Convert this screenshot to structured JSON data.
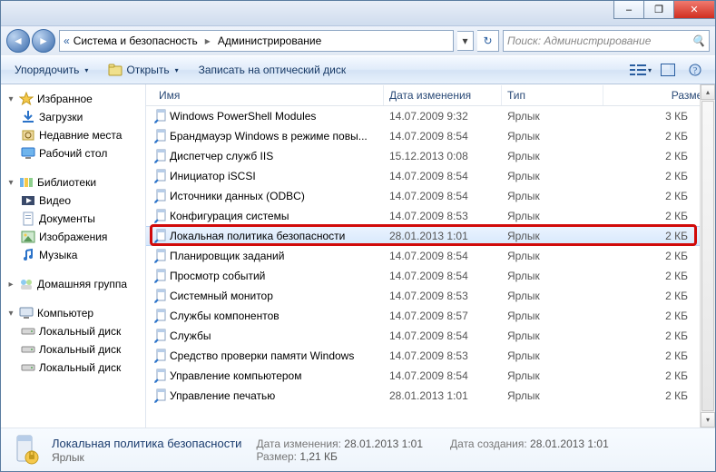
{
  "chrome": {
    "minimize": "–",
    "maximize": "❐",
    "close": "✕"
  },
  "address": {
    "back": "◄",
    "forward": "►",
    "crumbs": [
      "Система и безопасность",
      "Администрирование"
    ],
    "dropdown": "▾",
    "refresh": "↻"
  },
  "search": {
    "placeholder": "Поиск: Администрирование",
    "icon": "🔍"
  },
  "toolbar": {
    "organize": "Упорядочить",
    "open": "Открыть",
    "burn": "Записать на оптический диск",
    "dd": "▾"
  },
  "columns": {
    "name": "Имя",
    "date": "Дата изменения",
    "type": "Тип",
    "size": "Размер"
  },
  "nav": {
    "favorites": {
      "label": "Избранное",
      "items": [
        "Загрузки",
        "Недавние места",
        "Рабочий стол"
      ]
    },
    "libraries": {
      "label": "Библиотеки",
      "items": [
        "Видео",
        "Документы",
        "Изображения",
        "Музыка"
      ]
    },
    "homegroup": {
      "label": "Домашняя группа"
    },
    "computer": {
      "label": "Компьютер",
      "items": [
        "Локальный диск",
        "Локальный диск",
        "Локальный диск"
      ]
    }
  },
  "files": [
    {
      "name": "Windows PowerShell Modules",
      "date": "14.07.2009 9:32",
      "type": "Ярлык",
      "size": "3 КБ"
    },
    {
      "name": "Брандмауэр Windows в режиме повы...",
      "date": "14.07.2009 8:54",
      "type": "Ярлык",
      "size": "2 КБ"
    },
    {
      "name": "Диспетчер служб IIS",
      "date": "15.12.2013 0:08",
      "type": "Ярлык",
      "size": "2 КБ"
    },
    {
      "name": "Инициатор iSCSI",
      "date": "14.07.2009 8:54",
      "type": "Ярлык",
      "size": "2 КБ"
    },
    {
      "name": "Источники данных (ODBC)",
      "date": "14.07.2009 8:54",
      "type": "Ярлык",
      "size": "2 КБ"
    },
    {
      "name": "Конфигурация системы",
      "date": "14.07.2009 8:53",
      "type": "Ярлык",
      "size": "2 КБ"
    },
    {
      "name": "Локальная политика безопасности",
      "date": "28.01.2013 1:01",
      "type": "Ярлык",
      "size": "2 КБ"
    },
    {
      "name": "Планировщик заданий",
      "date": "14.07.2009 8:54",
      "type": "Ярлык",
      "size": "2 КБ"
    },
    {
      "name": "Просмотр событий",
      "date": "14.07.2009 8:54",
      "type": "Ярлык",
      "size": "2 КБ"
    },
    {
      "name": "Системный монитор",
      "date": "14.07.2009 8:53",
      "type": "Ярлык",
      "size": "2 КБ"
    },
    {
      "name": "Службы компонентов",
      "date": "14.07.2009 8:57",
      "type": "Ярлык",
      "size": "2 КБ"
    },
    {
      "name": "Службы",
      "date": "14.07.2009 8:54",
      "type": "Ярлык",
      "size": "2 КБ"
    },
    {
      "name": "Средство проверки памяти Windows",
      "date": "14.07.2009 8:53",
      "type": "Ярлык",
      "size": "2 КБ"
    },
    {
      "name": "Управление компьютером",
      "date": "14.07.2009 8:54",
      "type": "Ярлык",
      "size": "2 КБ"
    },
    {
      "name": "Управление печатью",
      "date": "28.01.2013 1:01",
      "type": "Ярлык",
      "size": "2 КБ"
    }
  ],
  "selectedIndex": 6,
  "details": {
    "title": "Локальная политика безопасности",
    "subtitle": "Ярлык",
    "date_modified_label": "Дата изменения:",
    "date_modified": "28.01.2013 1:01",
    "size_label": "Размер:",
    "size": "1,21 КБ",
    "date_created_label": "Дата создания:",
    "date_created": "28.01.2013 1:01"
  }
}
